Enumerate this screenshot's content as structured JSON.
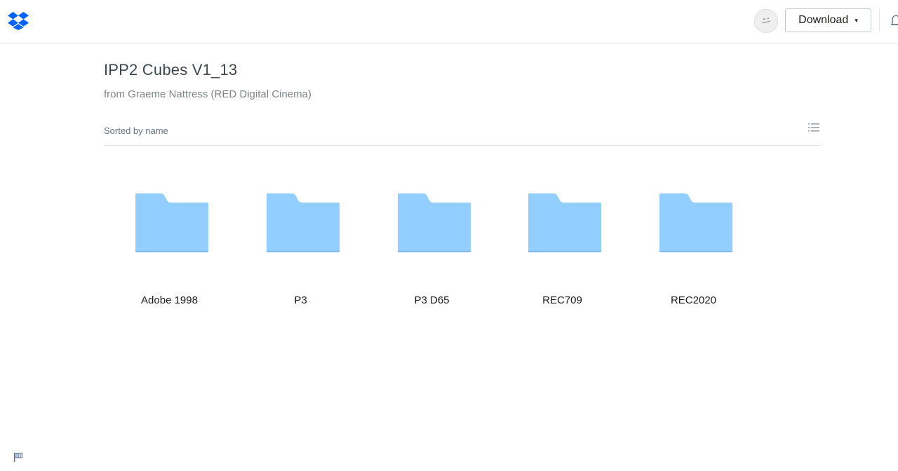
{
  "header": {
    "logo_icon": "dropbox-logo-icon",
    "avatar_icon": "avatar-icon",
    "download_label": "Download",
    "download_caret": "▾",
    "notification_icon": "bell-icon",
    "brand_color": "#0061fe"
  },
  "folder_info": {
    "title": "IPP2 Cubes V1_13",
    "owner": "from Graeme Nattress (RED Digital Cinema)"
  },
  "toolbar": {
    "sort_label": "Sorted by name",
    "view_toggle_icon": "list-view-icon"
  },
  "folders": [
    {
      "name": "Adobe 1998",
      "icon": "folder-icon"
    },
    {
      "name": "P3",
      "icon": "folder-icon"
    },
    {
      "name": "P3 D65",
      "icon": "folder-icon"
    },
    {
      "name": "REC709",
      "icon": "folder-icon"
    },
    {
      "name": "REC2020",
      "icon": "folder-icon"
    }
  ],
  "colors": {
    "folder_fill": "#92ceff",
    "folder_shadow": "#7fb9ec",
    "text_dark": "#1e1919",
    "text_muted": "#637282"
  },
  "footer": {
    "flag_icon": "report-flag-icon"
  }
}
